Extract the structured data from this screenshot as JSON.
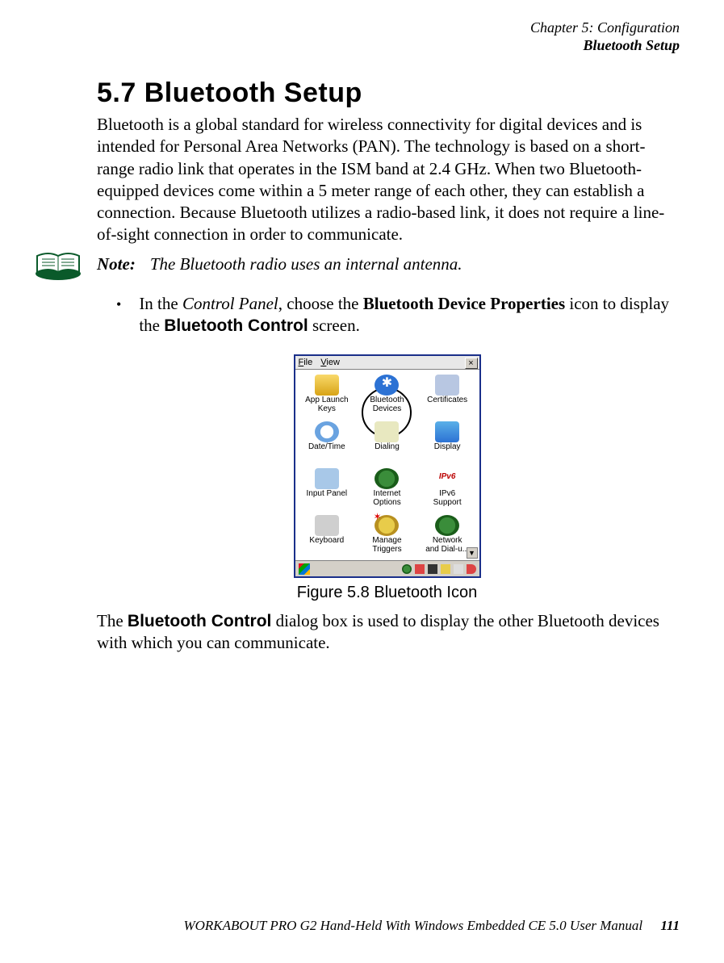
{
  "header": {
    "line1": "Chapter 5: Configuration",
    "line2": "Bluetooth Setup"
  },
  "section": {
    "title": "5.7  Bluetooth Setup",
    "intro": "Bluetooth is a global standard for wireless connectivity for digital devices and is intended for Personal Area Networks (PAN). The technology is based on a short-range radio link that operates in the ISM band at 2.4 GHz. When two Bluetooth-equipped devices come within a 5 meter range of each other, they can establish a connection. Because Bluetooth utilizes a radio-based link, it does not require a line-of-sight connection in order to communicate."
  },
  "note": {
    "label": "Note:",
    "text": "The Bluetooth radio uses an internal antenna."
  },
  "bullet": {
    "pre": "In the ",
    "cp": "Control Panel",
    "mid": ", choose the ",
    "bdp": "Bluetooth Device Properties",
    "post1": " icon to display the ",
    "btc": "Bluetooth Control",
    "post2": " screen."
  },
  "figure": {
    "menu_file": "File",
    "menu_view": "View",
    "close": "×",
    "items": [
      {
        "label1": "App Launch",
        "label2": "Keys",
        "cls": "ic-keys"
      },
      {
        "label1": "Bluetooth",
        "label2": "Devices",
        "cls": "ic-bt"
      },
      {
        "label1": "Certificates",
        "label2": "",
        "cls": "ic-cert"
      },
      {
        "label1": "Date/Time",
        "label2": "",
        "cls": "ic-clock"
      },
      {
        "label1": "Dialing",
        "label2": "",
        "cls": "ic-dial"
      },
      {
        "label1": "Display",
        "label2": "",
        "cls": "ic-disp"
      },
      {
        "label1": "Input Panel",
        "label2": "",
        "cls": "ic-input"
      },
      {
        "label1": "Internet",
        "label2": "Options",
        "cls": "ic-globe"
      },
      {
        "label1": "IPv6",
        "label2": "Support",
        "cls": "ic-ipv6"
      },
      {
        "label1": "Keyboard",
        "label2": "",
        "cls": "ic-kbd"
      },
      {
        "label1": "Manage",
        "label2": "Triggers",
        "cls": "ic-trig"
      },
      {
        "label1": "Network",
        "label2": "and Dial-u...",
        "cls": "ic-net"
      }
    ],
    "scroll": "▼",
    "caption": "Figure 5.8 Bluetooth Icon"
  },
  "after": {
    "pre": "The ",
    "btc": "Bluetooth Control",
    "post": " dialog box is used to display the other Bluetooth devices with which you can communicate."
  },
  "footer": {
    "text": "WORKABOUT PRO G2 Hand-Held With Windows Embedded CE 5.0 User Manual",
    "page": "111"
  }
}
